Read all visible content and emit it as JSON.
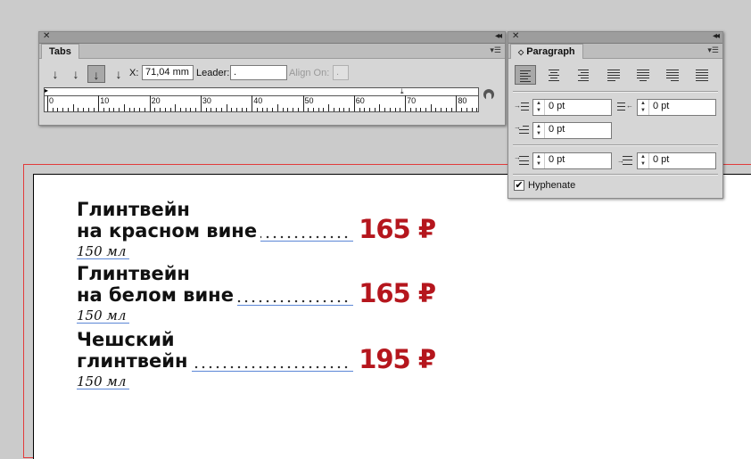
{
  "document": {
    "items": [
      {
        "name_line1": "Глинтвейн",
        "name_line2": "на красном вине",
        "price": "165 ₽",
        "volume": "150 мл"
      },
      {
        "name_line1": "Глинтвейн",
        "name_line2": "на белом вине",
        "price": "165 ₽",
        "volume": "150 мл"
      },
      {
        "name_line1": "Чешский",
        "name_line2": "глинтвейн",
        "price": "195 ₽",
        "volume": "150 мл"
      }
    ]
  },
  "tabs_panel": {
    "tab_label": "Tabs",
    "x_label": "X:",
    "x_value": "71,04 mm",
    "leader_label": "Leader:",
    "leader_value": ".",
    "align_on_label": "Align On:",
    "align_on_value": ".",
    "ruler_labels": [
      "0",
      "10",
      "20",
      "30",
      "40",
      "50",
      "60",
      "70",
      "80"
    ]
  },
  "paragraph_panel": {
    "tab_label": "Paragraph",
    "left_indent": "0 pt",
    "right_indent": "0 pt",
    "first_line_indent": "0 pt",
    "space_before": "0 pt",
    "space_after": "0 pt",
    "hyphenate_label": "Hyphenate",
    "hyphenate_checked": true
  },
  "colors": {
    "price": "#b5161d",
    "baseline": "#5b86d6",
    "margin_guide": "#e23b3b"
  }
}
